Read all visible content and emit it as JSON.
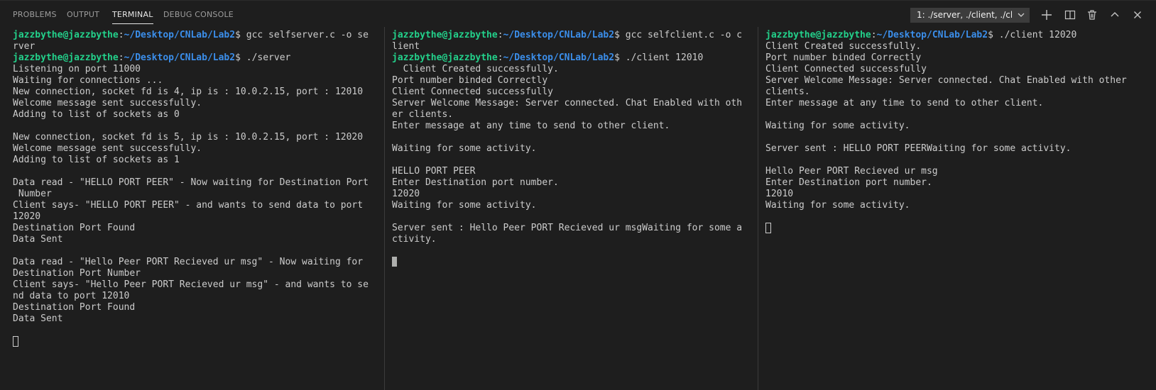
{
  "tabs": [
    {
      "label": "PROBLEMS"
    },
    {
      "label": "OUTPUT"
    },
    {
      "label": "TERMINAL"
    },
    {
      "label": "DEBUG CONSOLE"
    }
  ],
  "terminal_selector": {
    "label": "1: ./server, ./client, ./cli"
  },
  "toolbar_icons": [
    "plus-icon",
    "split-icon",
    "trash-icon",
    "chevron-up-icon",
    "close-icon"
  ],
  "colors": {
    "prompt_user": "#23d18b",
    "prompt_path": "#3b8eea",
    "text": "#cccccc"
  },
  "panes": [
    {
      "lines": [
        {
          "user": "jazzbythe@jazzbythe",
          "path": "~/Desktop/CNLab/Lab2",
          "cmd": "$ gcc selfserver.c -o se"
        },
        {
          "text": "rver"
        },
        {
          "user": "jazzbythe@jazzbythe",
          "path": "~/Desktop/CNLab/Lab2",
          "cmd": "$ ./server"
        },
        {
          "text": "Listening on port 11000"
        },
        {
          "text": "Waiting for connections ..."
        },
        {
          "text": "New connection, socket fd is 4, ip is : 10.0.2.15, port : 12010"
        },
        {
          "text": "Welcome message sent successfully."
        },
        {
          "text": "Adding to list of sockets as 0"
        },
        {
          "text": ""
        },
        {
          "text": "New connection, socket fd is 5, ip is : 10.0.2.15, port : 12020"
        },
        {
          "text": "Welcome message sent successfully."
        },
        {
          "text": "Adding to list of sockets as 1"
        },
        {
          "text": ""
        },
        {
          "text": "Data read - \"HELLO PORT PEER\" - Now waiting for Destination Port"
        },
        {
          "text": " Number"
        },
        {
          "text": "Client says- \"HELLO PORT PEER\" - and wants to send data to port"
        },
        {
          "text": "12020"
        },
        {
          "text": "Destination Port Found"
        },
        {
          "text": "Data Sent"
        },
        {
          "text": ""
        },
        {
          "text": "Data read - \"Hello Peer PORT Recieved ur msg\" - Now waiting for"
        },
        {
          "text": "Destination Port Number"
        },
        {
          "text": "Client says- \"Hello Peer PORT Recieved ur msg\" - and wants to se"
        },
        {
          "text": "nd data to port 12010"
        },
        {
          "text": "Destination Port Found"
        },
        {
          "text": "Data Sent"
        },
        {
          "text": ""
        },
        {
          "cursor": "hollow"
        }
      ]
    },
    {
      "lines": [
        {
          "user": "jazzbythe@jazzbythe",
          "path": "~/Desktop/CNLab/Lab2",
          "cmd": "$ gcc selfclient.c -o c"
        },
        {
          "text": "lient"
        },
        {
          "user": "jazzbythe@jazzbythe",
          "path": "~/Desktop/CNLab/Lab2",
          "cmd": "$ ./client 12010"
        },
        {
          "text": "  Client Created successfully."
        },
        {
          "text": "Port number binded Correctly"
        },
        {
          "text": "Client Connected successfully"
        },
        {
          "text": "Server Welcome Message: Server connected. Chat Enabled with oth"
        },
        {
          "text": "er clients."
        },
        {
          "text": "Enter message at any time to send to other client."
        },
        {
          "text": ""
        },
        {
          "text": "Waiting for some activity."
        },
        {
          "text": ""
        },
        {
          "text": "HELLO PORT PEER"
        },
        {
          "text": "Enter Destination port number."
        },
        {
          "text": "12020"
        },
        {
          "text": "Waiting for some activity."
        },
        {
          "text": ""
        },
        {
          "text": "Server sent : Hello Peer PORT Recieved ur msgWaiting for some a"
        },
        {
          "text": "ctivity."
        },
        {
          "text": ""
        },
        {
          "cursor": "solid"
        }
      ]
    },
    {
      "lines": [
        {
          "user": "jazzbythe@jazzbythe",
          "path": "~/Desktop/CNLab/Lab2",
          "cmd": "$ ./client 12020"
        },
        {
          "text": "Client Created successfully."
        },
        {
          "text": "Port number binded Correctly"
        },
        {
          "text": "Client Connected successfully"
        },
        {
          "text": "Server Welcome Message: Server connected. Chat Enabled with other"
        },
        {
          "text": "clients."
        },
        {
          "text": "Enter message at any time to send to other client."
        },
        {
          "text": ""
        },
        {
          "text": "Waiting for some activity."
        },
        {
          "text": ""
        },
        {
          "text": "Server sent : HELLO PORT PEERWaiting for some activity."
        },
        {
          "text": ""
        },
        {
          "text": "Hello Peer PORT Recieved ur msg"
        },
        {
          "text": "Enter Destination port number."
        },
        {
          "text": "12010"
        },
        {
          "text": "Waiting for some activity."
        },
        {
          "text": ""
        },
        {
          "cursor": "hollow"
        }
      ]
    }
  ]
}
